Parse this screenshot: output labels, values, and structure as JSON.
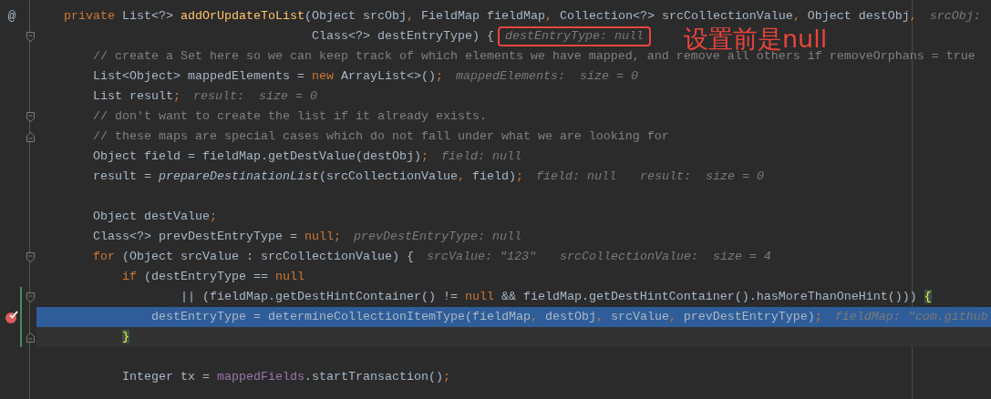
{
  "editor": {
    "lines": [
      {
        "gutter_text": "@",
        "code": [
          {
            "kind": "kw",
            "text": "private"
          },
          {
            "kind": "plain",
            "text": " List<?> "
          },
          {
            "kind": "decl",
            "text": "addOrUpdateToList"
          },
          {
            "kind": "plain",
            "text": "(Object srcObj"
          },
          {
            "kind": "kw",
            "text": ","
          },
          {
            "kind": "plain",
            "text": " FieldMap fieldMap"
          },
          {
            "kind": "kw",
            "text": ","
          },
          {
            "kind": "plain",
            "text": " Collection<?> srcCollectionValue"
          },
          {
            "kind": "kw",
            "text": ","
          },
          {
            "kind": "plain",
            "text": " Object destObj"
          },
          {
            "kind": "kw",
            "text": ","
          }
        ],
        "hints": [
          {
            "text": "srcObj:"
          }
        ]
      },
      {
        "fold_start": true,
        "code": [
          {
            "kind": "plain",
            "text": "                                  Class<?> destEntryType) {"
          }
        ],
        "hints": [
          {
            "text": "destEntryType: null",
            "boxed": true
          }
        ]
      },
      {
        "code": [
          {
            "kind": "comment",
            "text": "    // create a Set here so we can keep track of which elements we have mapped, and remove all others if removeOrphans = true"
          }
        ]
      },
      {
        "code": [
          {
            "kind": "plain",
            "text": "    List<Object> mappedElements = "
          },
          {
            "kind": "kw",
            "text": "new"
          },
          {
            "kind": "plain",
            "text": " ArrayList<>()"
          },
          {
            "kind": "kw",
            "text": ";"
          }
        ],
        "hints": [
          {
            "text": "mappedElements:  size = 0"
          }
        ]
      },
      {
        "code": [
          {
            "kind": "plain",
            "text": "    List result"
          },
          {
            "kind": "kw",
            "text": ";"
          }
        ],
        "hints": [
          {
            "text": "result:  size = 0"
          }
        ]
      },
      {
        "fold_start": true,
        "code": [
          {
            "kind": "comment",
            "text": "    // don't want to create the list if it already exists."
          }
        ]
      },
      {
        "fold_end": true,
        "code": [
          {
            "kind": "comment",
            "text": "    // these maps are special cases which do not fall under what we are looking for"
          }
        ]
      },
      {
        "code": [
          {
            "kind": "plain",
            "text": "    Object field = fieldMap.getDestValue(destObj)"
          },
          {
            "kind": "kw",
            "text": ";"
          }
        ],
        "hints": [
          {
            "text": "field: null"
          }
        ]
      },
      {
        "code": [
          {
            "kind": "plain",
            "text": "    result = "
          },
          {
            "kind": "italic",
            "text": "prepareDestinationList"
          },
          {
            "kind": "plain",
            "text": "(srcCollectionValue"
          },
          {
            "kind": "kw",
            "text": ","
          },
          {
            "kind": "plain",
            "text": " field)"
          },
          {
            "kind": "kw",
            "text": ";"
          }
        ],
        "hints": [
          {
            "text": "field: null"
          },
          {
            "text": "result:  size = 0"
          }
        ]
      },
      {
        "blank_before": true,
        "code": [
          {
            "kind": "plain",
            "text": "    Object destValue"
          },
          {
            "kind": "kw",
            "text": ";"
          }
        ]
      },
      {
        "code": [
          {
            "kind": "plain",
            "text": "    Class<?> prevDestEntryType = "
          },
          {
            "kind": "kw",
            "text": "null"
          },
          {
            "kind": "kw",
            "text": ";"
          }
        ],
        "hints": [
          {
            "text": "prevDestEntryType: null"
          }
        ]
      },
      {
        "fold_start": true,
        "code": [
          {
            "kind": "kw",
            "text": "    for"
          },
          {
            "kind": "plain",
            "text": " (Object srcValue : srcCollectionValue) {"
          }
        ],
        "hints": [
          {
            "text": "srcValue: \"123\""
          },
          {
            "text": "srcCollectionValue:  size = 4"
          }
        ]
      },
      {
        "code": [
          {
            "kind": "kw",
            "text": "        if"
          },
          {
            "kind": "plain",
            "text": " (destEntryType == "
          },
          {
            "kind": "kw",
            "text": "null"
          }
        ]
      },
      {
        "fold_start": true,
        "changed": true,
        "code": [
          {
            "kind": "plain",
            "text": "                || (fieldMap.getDestHintContainer() != "
          },
          {
            "kind": "kw",
            "text": "null"
          },
          {
            "kind": "plain",
            "text": " && fieldMap.getDestHintContainer().hasMoreThanOneHint())) "
          },
          {
            "kind": "brace",
            "text": "{"
          }
        ]
      },
      {
        "breakpoint": true,
        "changed": true,
        "execution_point": true,
        "code": [
          {
            "kind": "plain",
            "text": "            destEntryType = determineCollectionItemType(fieldMap"
          },
          {
            "kind": "kw",
            "text": ","
          },
          {
            "kind": "plain",
            "text": " destObj"
          },
          {
            "kind": "kw",
            "text": ","
          },
          {
            "kind": "plain",
            "text": " srcValue"
          },
          {
            "kind": "kw",
            "text": ","
          },
          {
            "kind": "plain",
            "text": " prevDestEntryType)"
          },
          {
            "kind": "kw",
            "text": ";"
          }
        ],
        "hints": [
          {
            "text": "fieldMap: \"com.github"
          }
        ]
      },
      {
        "fold_end": true,
        "changed": true,
        "current": true,
        "code": [
          {
            "kind": "brace",
            "text": "        }"
          }
        ]
      },
      {
        "blank_before": true,
        "code": [
          {
            "kind": "plain",
            "text": "        Integer tx = "
          },
          {
            "kind": "field",
            "text": "mappedFields"
          },
          {
            "kind": "plain",
            "text": ".startTransaction()"
          },
          {
            "kind": "kw",
            "text": ";"
          }
        ]
      }
    ]
  },
  "annotation": {
    "text": "设置前是null"
  }
}
